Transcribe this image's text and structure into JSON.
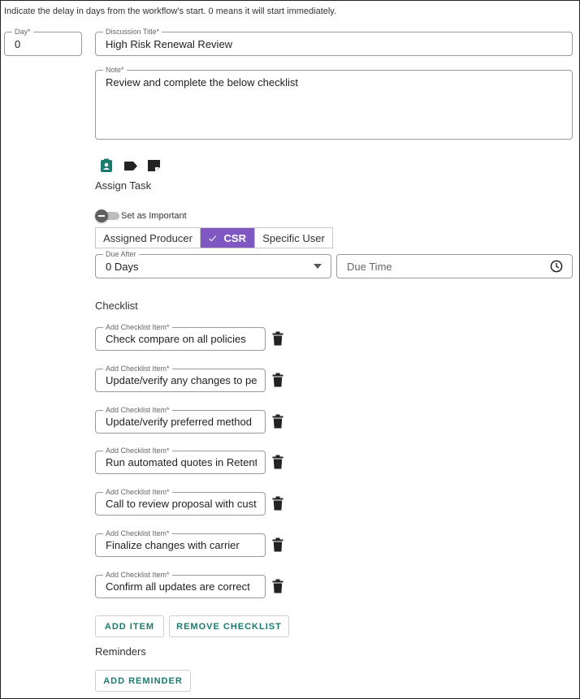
{
  "hint": "Indicate the delay in days from the workflow's start. 0 means it will start immediately.",
  "day": {
    "label": "Day*",
    "value": "0"
  },
  "discussion_title": {
    "label": "Discussion Title*",
    "value": "High Risk Renewal Review"
  },
  "note": {
    "label": "Note*",
    "value": "Review and complete the below checklist"
  },
  "icons": [
    "contact-badge-icon",
    "tag-icon",
    "note-icon"
  ],
  "assign_task": {
    "label": "Assign Task"
  },
  "important_toggle": {
    "label": "Set as Important",
    "on": false
  },
  "assignee_options": [
    {
      "label": "Assigned Producer",
      "selected": false
    },
    {
      "label": "CSR",
      "selected": true
    },
    {
      "label": "Specific User",
      "selected": false
    }
  ],
  "due_after": {
    "label": "Due After",
    "value": "0 Days"
  },
  "due_time": {
    "placeholder": "Due Time"
  },
  "checklist": {
    "title": "Checklist",
    "item_label": "Add Checklist Item*",
    "items": [
      "Check compare on all policies",
      "Update/verify any changes to pe",
      "Update/verify preferred method",
      "Run automated quotes in Retent",
      "Call to review proposal with cust",
      "Finalize changes with carrier",
      "Confirm all updates are correct"
    ]
  },
  "buttons": {
    "add_item": "ADD ITEM",
    "remove_checklist": "REMOVE CHECKLIST",
    "add_reminder": "ADD REMINDER"
  },
  "reminders": {
    "title": "Reminders"
  },
  "colors": {
    "accent_purple": "#7e57c2",
    "accent_teal": "#1b7a6e"
  }
}
